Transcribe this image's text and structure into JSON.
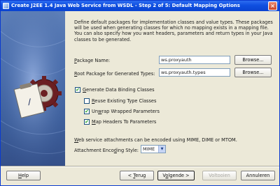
{
  "window": {
    "title": "Create J2EE 1.4 Java Web Service from WSDL - Step 2 of 5: Default Mapping Options",
    "close_glyph": "×"
  },
  "description": "Define default packages for implementation classes and value types. These packages will be used when generating classes for which no mapping exists in a mapping file. You can also specify how you want headers, parameters and return types in your Java classes to be generated.",
  "illustration_texts": {
    "clipboard": "/"
  },
  "form": {
    "package_name": {
      "label_mnemonic": "P",
      "label_rest": "ackage Name:",
      "value": "ws.proxyauth",
      "browse_label": "Browse..."
    },
    "root_package": {
      "label_mnemonic": "R",
      "label_rest": "oot Package for Generated Types:",
      "value": "ws.proxyauth.types",
      "browse_label": "Browse..."
    },
    "generate_data_binding": {
      "label_mnemonic": "G",
      "label_rest": "enerate Data Binding Classes",
      "checked": true
    },
    "reuse_existing": {
      "label_mnemonic": "R",
      "label_rest": "euse Existing Type Classes",
      "checked": false
    },
    "unwrap_wrapped": {
      "label_pre": "Un",
      "label_mnemonic": "w",
      "label_rest": "rap Wrapped Parameters",
      "checked": true
    },
    "map_headers": {
      "label_mnemonic": "M",
      "label_rest": "ap Headers To Parameters",
      "checked": true
    },
    "attachments_note_mnemonic": "W",
    "attachments_note_rest": "eb service attachments can be encoded using MIME, DIME or MTOM.",
    "encoding_style": {
      "label_pre": "Attachment Enco",
      "label_mnemonic": "d",
      "label_rest": "ing Style:",
      "value": "MIME",
      "arrow_glyph": "▼"
    }
  },
  "footer": {
    "help_mnemonic": "H",
    "help_rest": "elp",
    "back_pre": "< ",
    "back_mnemonic": "T",
    "back_rest": "erug",
    "next_pre": "V",
    "next_mnemonic": "o",
    "next_rest": "lgende >",
    "finish_label": "Voltooien",
    "cancel_label": "Annuleren"
  },
  "check_glyph": "✔"
}
